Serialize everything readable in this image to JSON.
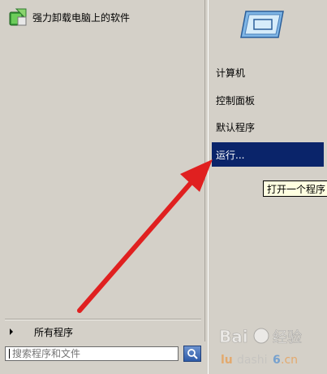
{
  "left_pane": {
    "program_item": {
      "label": "强力卸载电脑上的软件"
    },
    "all_programs_label": "所有程序",
    "search": {
      "placeholder": "搜索程序和文件"
    }
  },
  "right_pane": {
    "items": [
      {
        "label": "计算机"
      },
      {
        "label": "控制面板"
      },
      {
        "label": "默认程序"
      },
      {
        "label": "运行..."
      }
    ],
    "tooltip": "打开一个程序"
  },
  "colors": {
    "panel_bg": "#d4d0c8",
    "highlight": "#0a246a",
    "annotation_arrow": "#e02020"
  },
  "watermark": {
    "text": "Bai 经验",
    "site": "ludashi6.cn"
  }
}
